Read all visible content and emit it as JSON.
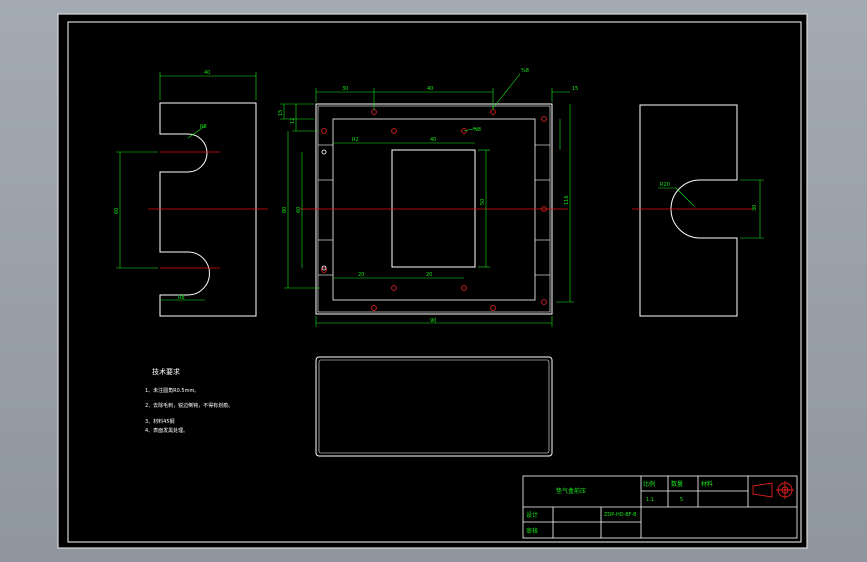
{
  "dimensions": {
    "left_width": "40",
    "left_radius": "R8",
    "left_height": "60",
    "left_slot": "R8",
    "top_left": "30",
    "top_mid": "40",
    "hole_tag": "%8",
    "right_offset": "15",
    "small_a": "15",
    "small_b": "12",
    "inner_a": "R2",
    "inner_b": "40",
    "inner_c": "%8",
    "height_outer": "80",
    "height_inner": "60",
    "window_h": "50",
    "right_tall": "116",
    "bottom_a": "20",
    "bottom_b": "20",
    "bottom_total": "90",
    "right_radius": "R20",
    "right_height": "30"
  },
  "notes": {
    "title": "技术要求",
    "line1": "1、未注圆角R0.5mm。",
    "line2": "2、去除毛刺，锐边倒钝，不得有划痕。",
    "line3": "3、材料45钢",
    "line4": "4、表面发黑处理。"
  },
  "title_block": {
    "part_name": "垫气盒前压",
    "scale_label": "比例",
    "scale_value": "1:1",
    "qty_label": "数量",
    "qty_value": "5",
    "material_label": "材料",
    "designer_label": "设计",
    "checker_label": "审核",
    "code": "ZDP-HD-BF-B"
  },
  "colors": {
    "outline": "#ffffff",
    "dimension": "#19e619",
    "center": "#e01010",
    "hole": "#e02020"
  }
}
